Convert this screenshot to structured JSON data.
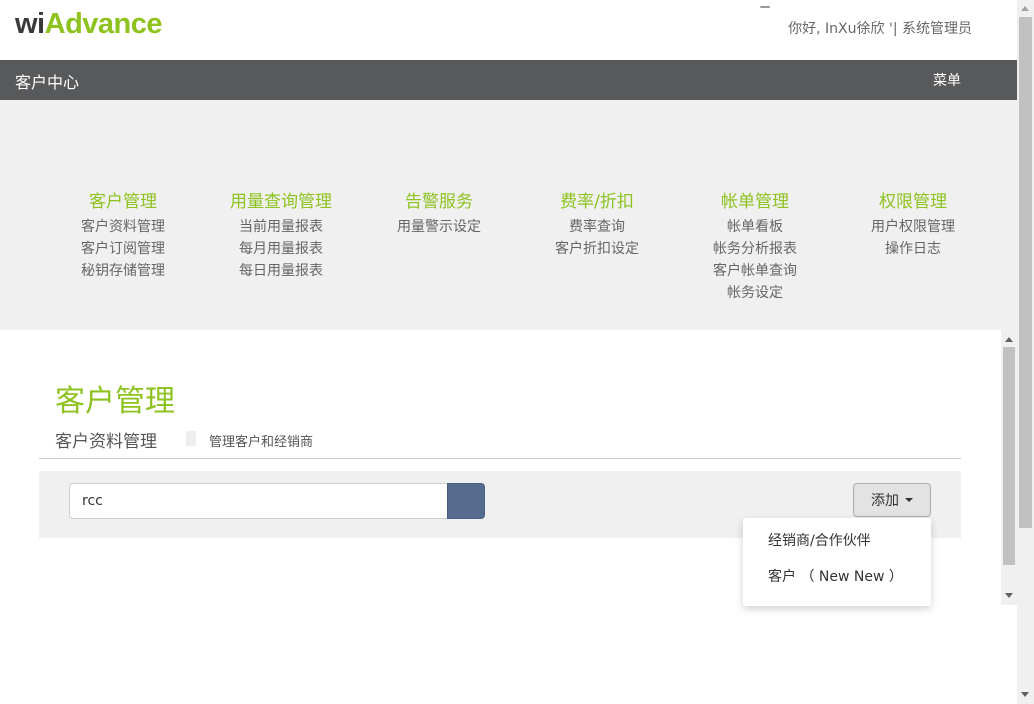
{
  "header": {
    "logo_part1": "wi",
    "logo_part2": "Advance",
    "greeting": "你好, InXu徐欣 '| 系统管理员"
  },
  "nav": {
    "title": "客户中心",
    "menu_label": "菜单"
  },
  "mega_menu": {
    "columns": [
      {
        "heading": "客户管理",
        "items": [
          "客户资料管理",
          "客户订阅管理",
          "秘钥存储管理"
        ]
      },
      {
        "heading": "用量查询管理",
        "items": [
          "当前用量报表",
          "每月用量报表",
          "每日用量报表"
        ]
      },
      {
        "heading": "告警服务",
        "items": [
          "用量警示设定"
        ]
      },
      {
        "heading": "费率/折扣",
        "items": [
          "费率查询",
          "客户折扣设定"
        ]
      },
      {
        "heading": "帐单管理",
        "items": [
          "帐单看板",
          "帐务分析报表",
          "客户帐单查询",
          "帐务设定"
        ]
      },
      {
        "heading": "权限管理",
        "items": [
          "用户权限管理",
          "操作日志"
        ]
      }
    ]
  },
  "page": {
    "title": "客户管理",
    "subtitle": "客户资料管理",
    "description": "管理客户和经销商"
  },
  "search": {
    "value": "rcc"
  },
  "add_button": {
    "label": "添加"
  },
  "dropdown": {
    "items": [
      "经销商/合作伙伴",
      "客户 （ New New ）"
    ]
  },
  "colors": {
    "accent_green": "#8dc21f",
    "nav_bg": "#58595b",
    "search_button": "#566c8f"
  }
}
